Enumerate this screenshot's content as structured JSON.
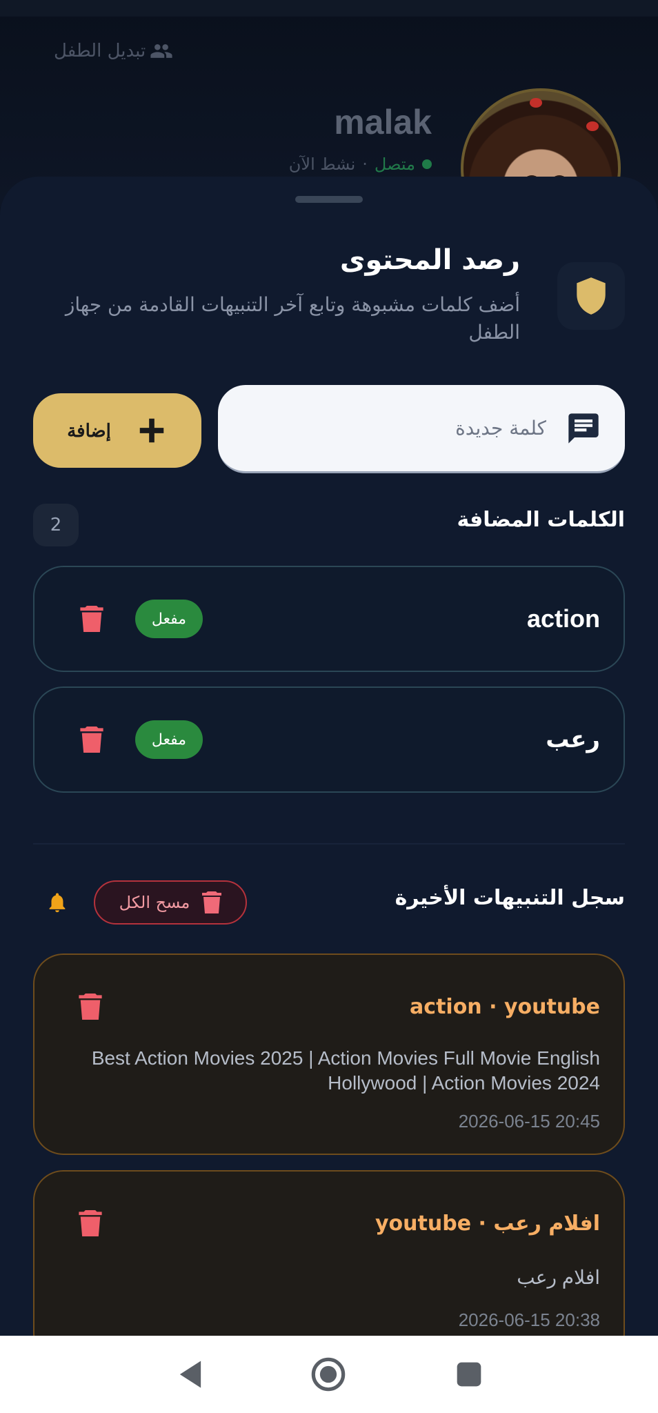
{
  "background": {
    "switch_child_label": "تبديل الطفل",
    "child_name": "malak",
    "status_online": "متصل",
    "status_separator": "·",
    "status_active": "نشط الآن"
  },
  "sheet": {
    "title": "رصد المحتوى",
    "subtitle": "أضف كلمات مشبوهة وتابع آخر التنبيهات القادمة من جهاز الطفل",
    "input_placeholder": "كلمة جديدة",
    "add_label": "إضافة",
    "words_section_title": "الكلمات المضافة",
    "words_count": "2",
    "words": [
      {
        "word": "action",
        "status": "مفعل"
      },
      {
        "word": "رعب",
        "status": "مفعل"
      }
    ],
    "alerts_section_title": "سجل التنبيهات الأخيرة",
    "clear_all_label": "مسح الكل",
    "alerts": [
      {
        "title": "action · youtube",
        "body": "Best Action Movies 2025 | Action Movies Full Movie English Hollywood | Action Movies 2024",
        "time": "2026-06-15 20:45"
      },
      {
        "title": "افلام رعب · youtube",
        "body": "افلام رعب",
        "time": "2026-06-15 20:38"
      }
    ]
  },
  "colors": {
    "accent": "#dcbb6a",
    "active_pill": "#2a8a3e",
    "danger": "#ef5f6a",
    "alert_title": "#f7ae64",
    "bell": "#f0a319"
  },
  "icons": {
    "switch_child": "people-icon",
    "header": "shield-icon",
    "input": "message-icon",
    "add": "plus-icon",
    "delete": "trash-icon",
    "alerts": "bell-icon",
    "nav": [
      "back-icon",
      "home-icon",
      "recents-icon"
    ]
  }
}
